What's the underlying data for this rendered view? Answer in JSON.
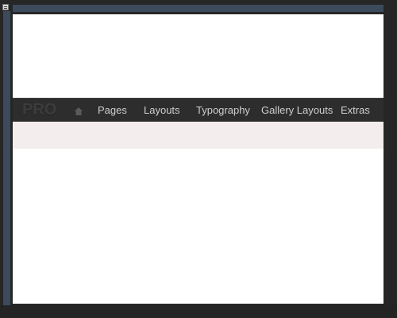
{
  "logo_text": "PRO",
  "nav": {
    "items": [
      {
        "label": "Pages"
      },
      {
        "label": "Layouts"
      },
      {
        "label": "Typography"
      },
      {
        "label": "Gallery Layouts"
      },
      {
        "label": "Extras"
      }
    ],
    "home_icon": "home-icon"
  },
  "colors": {
    "background": "#262626",
    "frame_border": "#3c4a5c",
    "navbar": "#2d2d2d",
    "nav_text": "#cfcfcf",
    "sub_band": "#f3eded"
  }
}
